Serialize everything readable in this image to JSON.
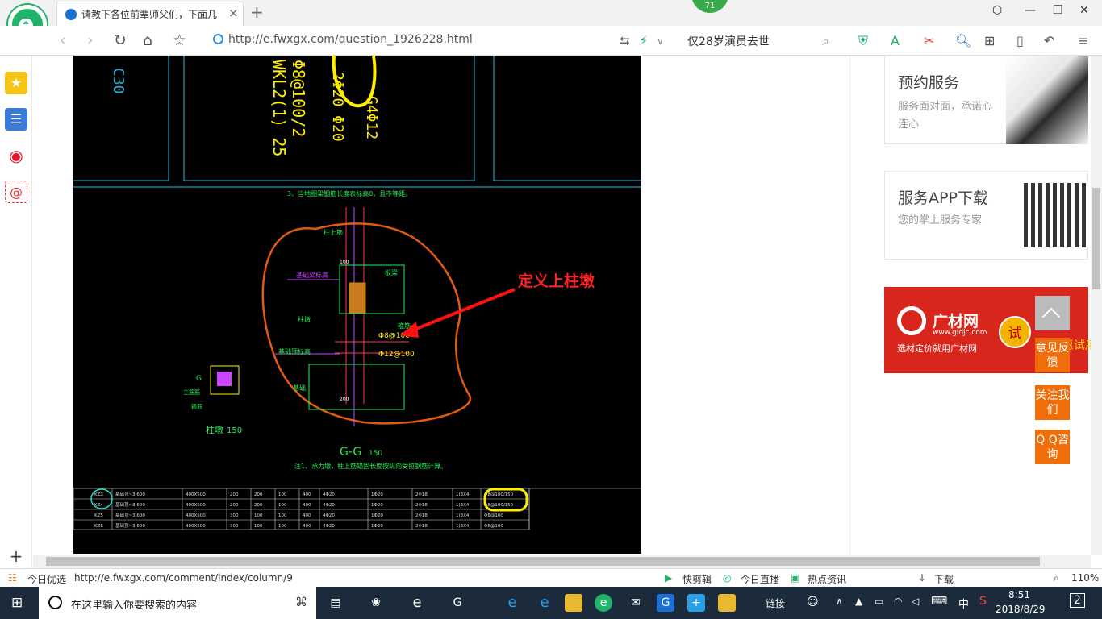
{
  "browser": {
    "tab_title": "请教下各位前辈师父们，下面几",
    "tab_close": "×",
    "new_tab": "+",
    "update_badge": "71",
    "url": "http://e.fwxgx.com/question_1926228.html",
    "search_query": "仅28岁演员去世",
    "icons": [
      "back-icon",
      "forward-icon",
      "refresh-icon",
      "home-icon",
      "star-icon",
      "share-icon",
      "lightning-icon",
      "shield-icon",
      "translate-icon",
      "scissors-icon",
      "search-icon",
      "apps-icon",
      "reader-icon",
      "undo-icon",
      "menu-icon"
    ]
  },
  "sidebar": {
    "add": "+"
  },
  "drawing": {
    "annotation": "定义上柱墩",
    "top_labels": [
      "WKL2(1) 25",
      "Φ8@100/2",
      "2Φ20 Φ20",
      "G4Φ12",
      "Φ8@100",
      "C30"
    ],
    "note_line": "3、当地圈梁钢筋长度表标高0，且不等距。",
    "section_labels": {
      "column": "柱上筋",
      "beam_top": "板梁",
      "beam_sub": "基础梁标高",
      "stirrup": "Φ8@100",
      "main_bar": "Φ12@100",
      "base": "基础顶标高",
      "pier": "柱墩",
      "base2": "基础",
      "dim1": "100",
      "dim2": "200",
      "stirrup_tag": "箍筋"
    },
    "small_section": {
      "name": "G",
      "caption": "柱墩",
      "scale": "150",
      "main": "主筋筋",
      "hoop": "箍筋"
    },
    "section_title": "G-G",
    "section_scale": "150",
    "note": "注1、承力墩，柱上筋锚固长度按纵向受拉钢筋计算。",
    "table": [
      [
        "KZ3",
        "基础顶~3.600",
        "400X500",
        "200",
        "200",
        "100",
        "400",
        "4Φ20",
        "1Φ20",
        "2Φ18",
        "1(3X4)",
        "Φ8@100/150"
      ],
      [
        "KZ4",
        "基础顶~3.600",
        "400X500",
        "200",
        "200",
        "100",
        "400",
        "4Φ20",
        "1Φ20",
        "2Φ18",
        "1(3X4)",
        "Φ8@100/150"
      ],
      [
        "KZ5",
        "基础顶~3.600",
        "400X500",
        "300",
        "100",
        "100",
        "400",
        "4Φ20",
        "1Φ20",
        "2Φ18",
        "1(3X4)",
        "Φ8@100"
      ],
      [
        "KZ6",
        "基础顶~3.600",
        "400X500",
        "300",
        "100",
        "100",
        "400",
        "4Φ20",
        "1Φ20",
        "2Φ18",
        "1(3X4)",
        "Φ8@100"
      ]
    ]
  },
  "right": {
    "card1": {
      "title": "预约服务",
      "desc": "服务面对面，承诺心连心"
    },
    "card2": {
      "title": "服务APP下载",
      "desc": "您的掌上服务专家"
    },
    "ad": {
      "name": "广材网",
      "domain": "www.gldjc.com",
      "slogan": "选材定价就用广材网",
      "try": "试",
      "yh": "P 优惠试用"
    },
    "float": {
      "feedback": "意见反馈",
      "follow": "关注我们",
      "qq": "Q Q咨询"
    }
  },
  "status": {
    "left": "今日优选",
    "link": "http://e.fwxgx.com/comment/index/column/9",
    "items": [
      "快剪辑",
      "今日直播",
      "热点资讯",
      "下载"
    ],
    "zoom": "110%"
  },
  "taskbar": {
    "search": "在这里输入你要搜索的内容",
    "link": "链接",
    "ime": "中",
    "time": "8:51",
    "date": "2018/8/29",
    "notif": "2"
  },
  "colors": {
    "green": "#1fb46a",
    "orange": "#f06e0a",
    "ad_red": "#d9261c",
    "cad_bg": "#000000",
    "taskbar": "#1c2b3b"
  }
}
